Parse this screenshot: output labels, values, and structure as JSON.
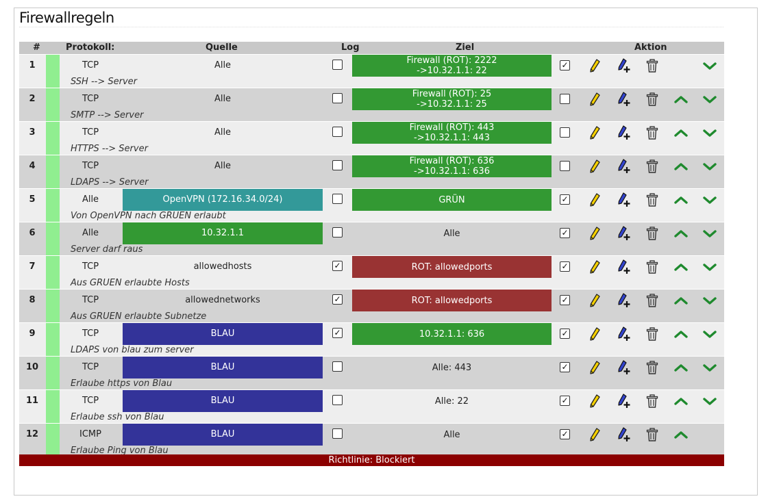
{
  "page": {
    "title": "Firewallregeln"
  },
  "table": {
    "headers": {
      "num": "#",
      "protocol": "Protokoll:",
      "source": "Quelle",
      "log": "Log",
      "target": "Ziel",
      "action": "Aktion"
    },
    "colors": {
      "green": "#339933",
      "red": "#993333",
      "blue": "#333399",
      "teal": "#339999",
      "stripe": "#90ee90",
      "footer": "#8b0000"
    },
    "rows": [
      {
        "num": "1",
        "protocol": "TCP",
        "source": "Alle",
        "source_color": "",
        "log": false,
        "target_line1": "Firewall (ROT): 2222",
        "target_line2": "->10.32.1.1: 22",
        "target_color": "green",
        "enabled": true,
        "description": "SSH --> Server",
        "up": false,
        "down": true
      },
      {
        "num": "2",
        "protocol": "TCP",
        "source": "Alle",
        "source_color": "",
        "log": false,
        "target_line1": "Firewall (ROT): 25",
        "target_line2": "->10.32.1.1: 25",
        "target_color": "green",
        "enabled": false,
        "description": "SMTP --> Server",
        "up": true,
        "down": true
      },
      {
        "num": "3",
        "protocol": "TCP",
        "source": "Alle",
        "source_color": "",
        "log": false,
        "target_line1": "Firewall (ROT): 443",
        "target_line2": "->10.32.1.1: 443",
        "target_color": "green",
        "enabled": false,
        "description": "HTTPS --> Server",
        "up": true,
        "down": true
      },
      {
        "num": "4",
        "protocol": "TCP",
        "source": "Alle",
        "source_color": "",
        "log": false,
        "target_line1": "Firewall (ROT): 636",
        "target_line2": "->10.32.1.1: 636",
        "target_color": "green",
        "enabled": false,
        "description": "LDAPS --> Server",
        "up": true,
        "down": true
      },
      {
        "num": "5",
        "protocol": "Alle",
        "source": "OpenVPN (172.16.34.0/24)",
        "source_color": "teal",
        "log": false,
        "target_line1": "GRÜN",
        "target_line2": "",
        "target_color": "green",
        "enabled": true,
        "description": "Von OpenVPN nach GRUEN erlaubt",
        "up": true,
        "down": true
      },
      {
        "num": "6",
        "protocol": "Alle",
        "source": "10.32.1.1",
        "source_color": "green",
        "log": false,
        "target_line1": "Alle",
        "target_line2": "",
        "target_color": "",
        "enabled": true,
        "description": "Server darf raus",
        "up": true,
        "down": true
      },
      {
        "num": "7",
        "protocol": "TCP",
        "source": "allowedhosts",
        "source_color": "",
        "log": true,
        "target_line1": "ROT: allowedports",
        "target_line2": "",
        "target_color": "red",
        "enabled": true,
        "description": "Aus GRUEN erlaubte Hosts",
        "up": true,
        "down": true
      },
      {
        "num": "8",
        "protocol": "TCP",
        "source": "allowednetworks",
        "source_color": "",
        "log": true,
        "target_line1": "ROT: allowedports",
        "target_line2": "",
        "target_color": "red",
        "enabled": true,
        "description": "Aus GRUEN erlaubte Subnetze",
        "up": true,
        "down": true
      },
      {
        "num": "9",
        "protocol": "TCP",
        "source": "BLAU",
        "source_color": "blue",
        "log": true,
        "target_line1": "10.32.1.1: 636",
        "target_line2": "",
        "target_color": "green",
        "enabled": true,
        "description": "LDAPS von blau zum server",
        "up": true,
        "down": true
      },
      {
        "num": "10",
        "protocol": "TCP",
        "source": "BLAU",
        "source_color": "blue",
        "log": false,
        "target_line1": "Alle: 443",
        "target_line2": "",
        "target_color": "",
        "enabled": true,
        "description": "Erlaube https von Blau",
        "up": true,
        "down": true
      },
      {
        "num": "11",
        "protocol": "TCP",
        "source": "BLAU",
        "source_color": "blue",
        "log": false,
        "target_line1": "Alle: 22",
        "target_line2": "",
        "target_color": "",
        "enabled": true,
        "description": "Erlaube ssh von Blau",
        "up": true,
        "down": true
      },
      {
        "num": "12",
        "protocol": "ICMP",
        "source": "BLAU",
        "source_color": "blue",
        "log": false,
        "target_line1": "Alle",
        "target_line2": "",
        "target_color": "",
        "enabled": true,
        "description": "Erlaube Ping von Blau",
        "up": true,
        "down": false
      }
    ],
    "icons": {
      "edit": "pencil-icon",
      "copy": "add-pen-icon",
      "delete": "trash-icon",
      "up": "chevron-up-icon",
      "down": "chevron-down-icon",
      "enabled": "checkbox-icon"
    },
    "footer": "Richtlinie: Blockiert"
  }
}
